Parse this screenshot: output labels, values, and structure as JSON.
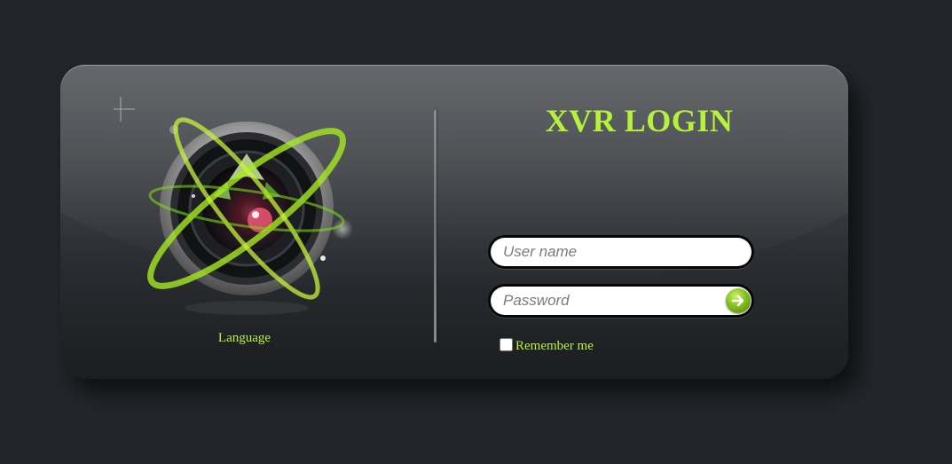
{
  "login": {
    "title": "XVR LOGIN",
    "language_label": "Language",
    "username_placeholder": "User name",
    "password_placeholder": "Password",
    "username_value": "",
    "password_value": "",
    "remember_label": "Remember me",
    "remember_checked": false,
    "submit_icon": "arrow-right-icon",
    "logo_icon": "camera-lens-icon"
  },
  "colors": {
    "accent": "#b6f23a",
    "background": "#22252a",
    "panel_top": "#5a5d61",
    "panel_bottom": "#1b1d20",
    "submit_green": "#83c11d"
  }
}
